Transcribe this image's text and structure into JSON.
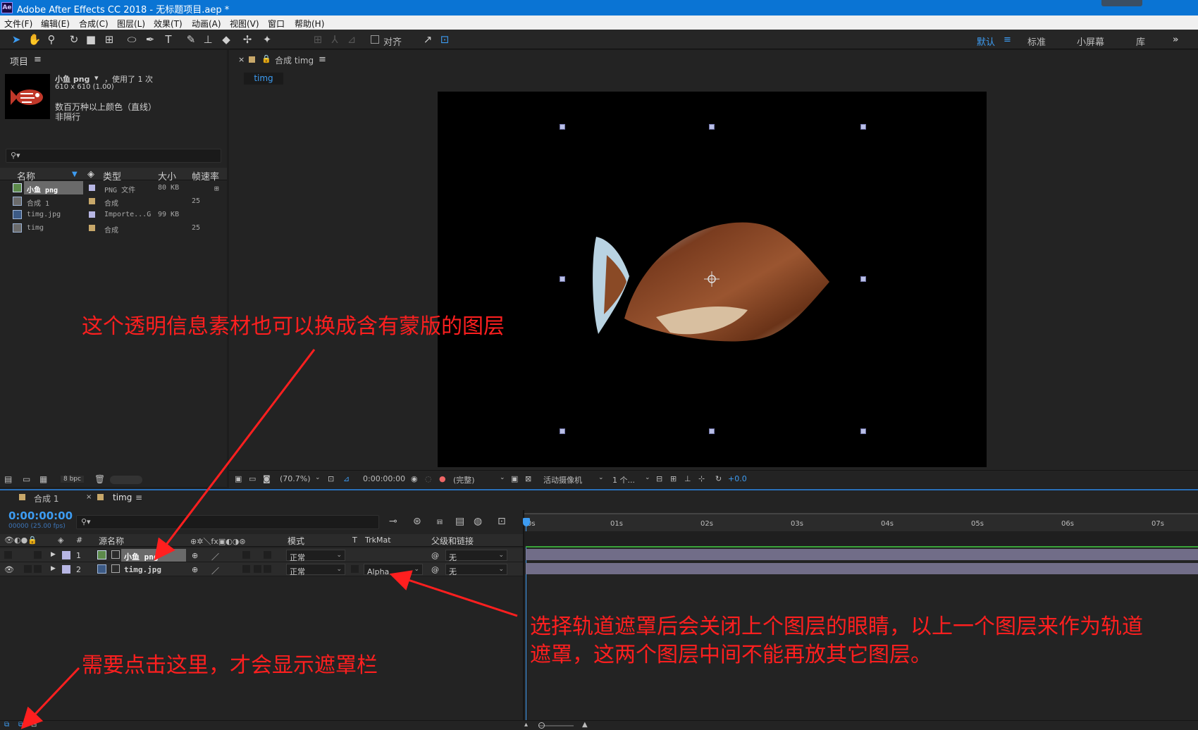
{
  "app": {
    "title": "Adobe After Effects CC 2018 - 无标题项目.aep *",
    "icon": "Ae"
  },
  "menu": [
    "文件(F)",
    "编辑(E)",
    "合成(C)",
    "图层(L)",
    "效果(T)",
    "动画(A)",
    "视图(V)",
    "窗口",
    "帮助(H)"
  ],
  "toolbar": {
    "align_label": "对齐",
    "workspaces": [
      "默认",
      "标准",
      "小屏幕",
      "库"
    ],
    "active_workspace": "默认",
    "more": "»"
  },
  "project": {
    "panel_title": "项目",
    "selected": {
      "name": "小鱼 png",
      "used": "，使用了 1 次",
      "size": "610 x 610 (1.00)",
      "color": "数百万种以上颜色（直线）",
      "interlace": "非隔行"
    },
    "search_placeholder": "",
    "columns": [
      "名称",
      "类型",
      "大小",
      "帧速率"
    ],
    "items": [
      {
        "name": "小鱼 png",
        "type": "PNG 文件",
        "size": "80 KB",
        "fps": "",
        "swatch": "#b7b6e3"
      },
      {
        "name": "合成 1",
        "type": "合成",
        "size": "",
        "fps": "25",
        "swatch": "#c8a86a"
      },
      {
        "name": "timg.jpg",
        "type": "Importe...G",
        "size": "99 KB",
        "fps": "",
        "swatch": "#b7b6e3"
      },
      {
        "name": "timg",
        "type": "合成",
        "size": "",
        "fps": "25",
        "swatch": "#c8a86a"
      }
    ],
    "bpc": "8 bpc"
  },
  "viewer": {
    "panel_title": "合成 timg",
    "tab": "timg",
    "zoom": "(70.7%)",
    "time": "0:00:00:00",
    "resolution": "(完整)",
    "camera": "活动摄像机",
    "views": "1 个...",
    "exposure": "+0.0"
  },
  "timeline": {
    "tabs": [
      "合成 1",
      "timg"
    ],
    "active_tab": "timg",
    "timecode": "0:00:00:00",
    "fps_note": "00000 (25.00 fps)",
    "columns": {
      "num": "#",
      "source": "源名称",
      "mode": "模式",
      "t": "T",
      "trkmat": "TrkMat",
      "parent": "父级和链接"
    },
    "layers": [
      {
        "num": "1",
        "name": "小鱼 png",
        "mode": "正常",
        "trkmat": "",
        "parent": "无",
        "color": "#b7b6e3"
      },
      {
        "num": "2",
        "name": "timg.jpg",
        "mode": "正常",
        "trkmat": "Alpha",
        "parent": "无",
        "color": "#b7b6e3"
      }
    ],
    "ruler": [
      "0s",
      "01s",
      "02s",
      "03s",
      "04s",
      "05s",
      "06s",
      "07s"
    ]
  },
  "annotations": [
    "这个透明信息素材也可以换成含有蒙版的图层",
    "选择轨道遮罩后会关闭上个图层的眼睛，以上一个图层来作为轨道",
    "遮罩，这两个图层中间不能再放其它图层。",
    "需要点击这里，才会显示遮罩栏"
  ],
  "colors": {
    "accent": "#3d9cf2",
    "annotation": "#ff1f1f",
    "titlebar": "#0a74d4"
  }
}
